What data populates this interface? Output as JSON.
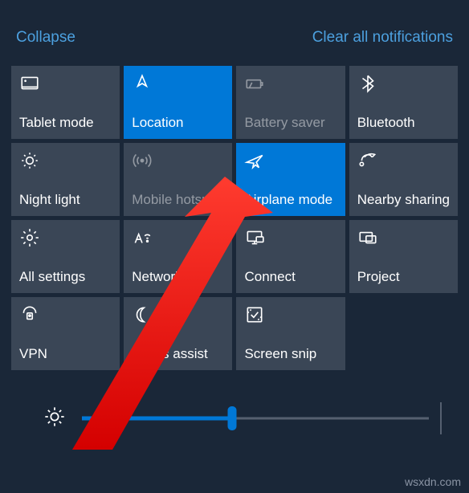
{
  "header": {
    "collapse": "Collapse",
    "clear": "Clear all notifications"
  },
  "tiles": [
    {
      "id": "tablet-mode",
      "label": "Tablet mode",
      "icon": "tablet-icon",
      "active": false,
      "disabled": false
    },
    {
      "id": "location",
      "label": "Location",
      "icon": "location-icon",
      "active": true,
      "disabled": false
    },
    {
      "id": "battery-saver",
      "label": "Battery saver",
      "icon": "battery-icon",
      "active": false,
      "disabled": true
    },
    {
      "id": "bluetooth",
      "label": "Bluetooth",
      "icon": "bluetooth-icon",
      "active": false,
      "disabled": false
    },
    {
      "id": "night-light",
      "label": "Night light",
      "icon": "sun-icon",
      "active": false,
      "disabled": false
    },
    {
      "id": "mobile-hotspot",
      "label": "Mobile hotspot",
      "icon": "hotspot-icon",
      "active": false,
      "disabled": true
    },
    {
      "id": "airplane-mode",
      "label": "Airplane mode",
      "icon": "airplane-icon",
      "active": true,
      "disabled": false
    },
    {
      "id": "nearby-sharing",
      "label": "Nearby sharing",
      "icon": "share-icon",
      "active": false,
      "disabled": false
    },
    {
      "id": "all-settings",
      "label": "All settings",
      "icon": "gear-icon",
      "active": false,
      "disabled": false
    },
    {
      "id": "network",
      "label": "Network",
      "icon": "network-icon",
      "active": false,
      "disabled": false
    },
    {
      "id": "connect",
      "label": "Connect",
      "icon": "connect-icon",
      "active": false,
      "disabled": false
    },
    {
      "id": "project",
      "label": "Project",
      "icon": "project-icon",
      "active": false,
      "disabled": false
    },
    {
      "id": "vpn",
      "label": "VPN",
      "icon": "vpn-icon",
      "active": false,
      "disabled": false
    },
    {
      "id": "focus-assist",
      "label": "Focus assist",
      "icon": "moon-icon",
      "active": false,
      "disabled": false
    },
    {
      "id": "screen-snip",
      "label": "Screen snip",
      "icon": "snip-icon",
      "active": false,
      "disabled": false
    }
  ],
  "brightness": {
    "value": 42
  },
  "watermark": "wsxdn.com",
  "colors": {
    "accent": "#0078d7",
    "tile": "#3a4656",
    "background": "#1a2738",
    "link": "#4ca0df"
  }
}
